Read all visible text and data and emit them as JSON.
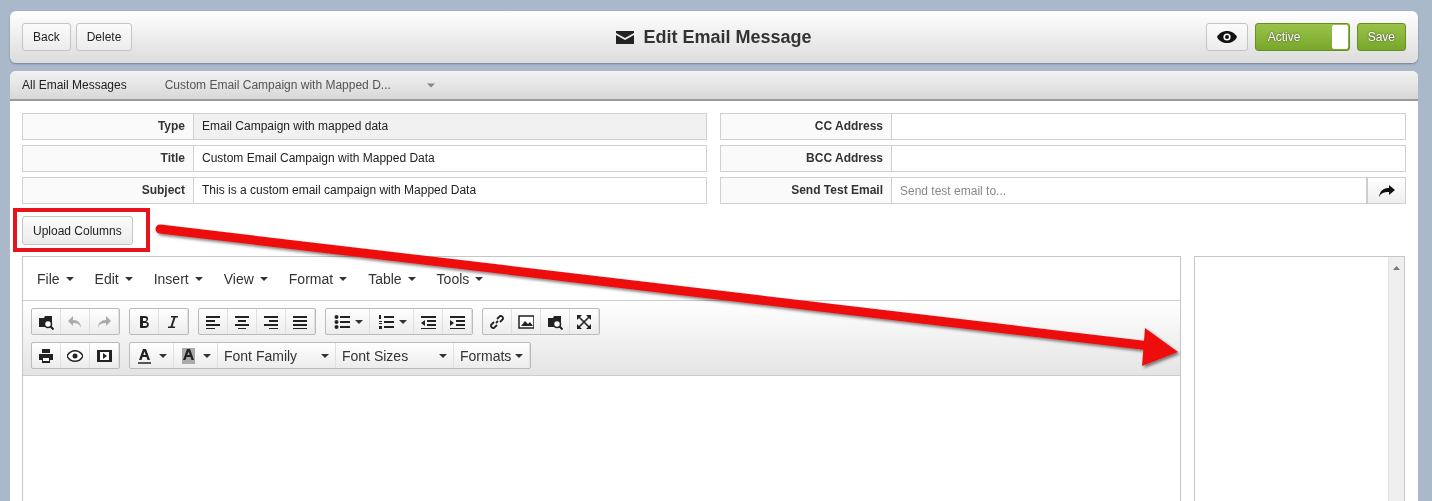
{
  "header": {
    "buttons": [
      "Back",
      "Delete"
    ],
    "title": "Edit Email Message",
    "active_toggle": {
      "label": "Active",
      "on": true
    },
    "save": "Save"
  },
  "breadcrumb": {
    "root": "All Email Messages",
    "current": "Custom Email Campaign with Mapped D..."
  },
  "fields_left": [
    {
      "label": "Type",
      "value": "Email Campaign with mapped data",
      "readonly": true
    },
    {
      "label": "Title",
      "value": "Custom Email Campaign with Mapped Data",
      "readonly": false
    },
    {
      "label": "Subject",
      "value": "This is a custom email campaign with Mapped Data",
      "readonly": false
    }
  ],
  "fields_right": [
    {
      "label": "CC Address",
      "kind": "text"
    },
    {
      "label": "BCC Address",
      "kind": "text"
    },
    {
      "label": "Send Test Email",
      "kind": "send",
      "placeholder": "Send test email to..."
    }
  ],
  "upload_button": "Upload Columns",
  "editor": {
    "menu": [
      "File",
      "Edit",
      "Insert",
      "View",
      "Format",
      "Table",
      "Tools"
    ],
    "dropdowns": [
      "Font Family",
      "Font Sizes",
      "Formats"
    ]
  }
}
